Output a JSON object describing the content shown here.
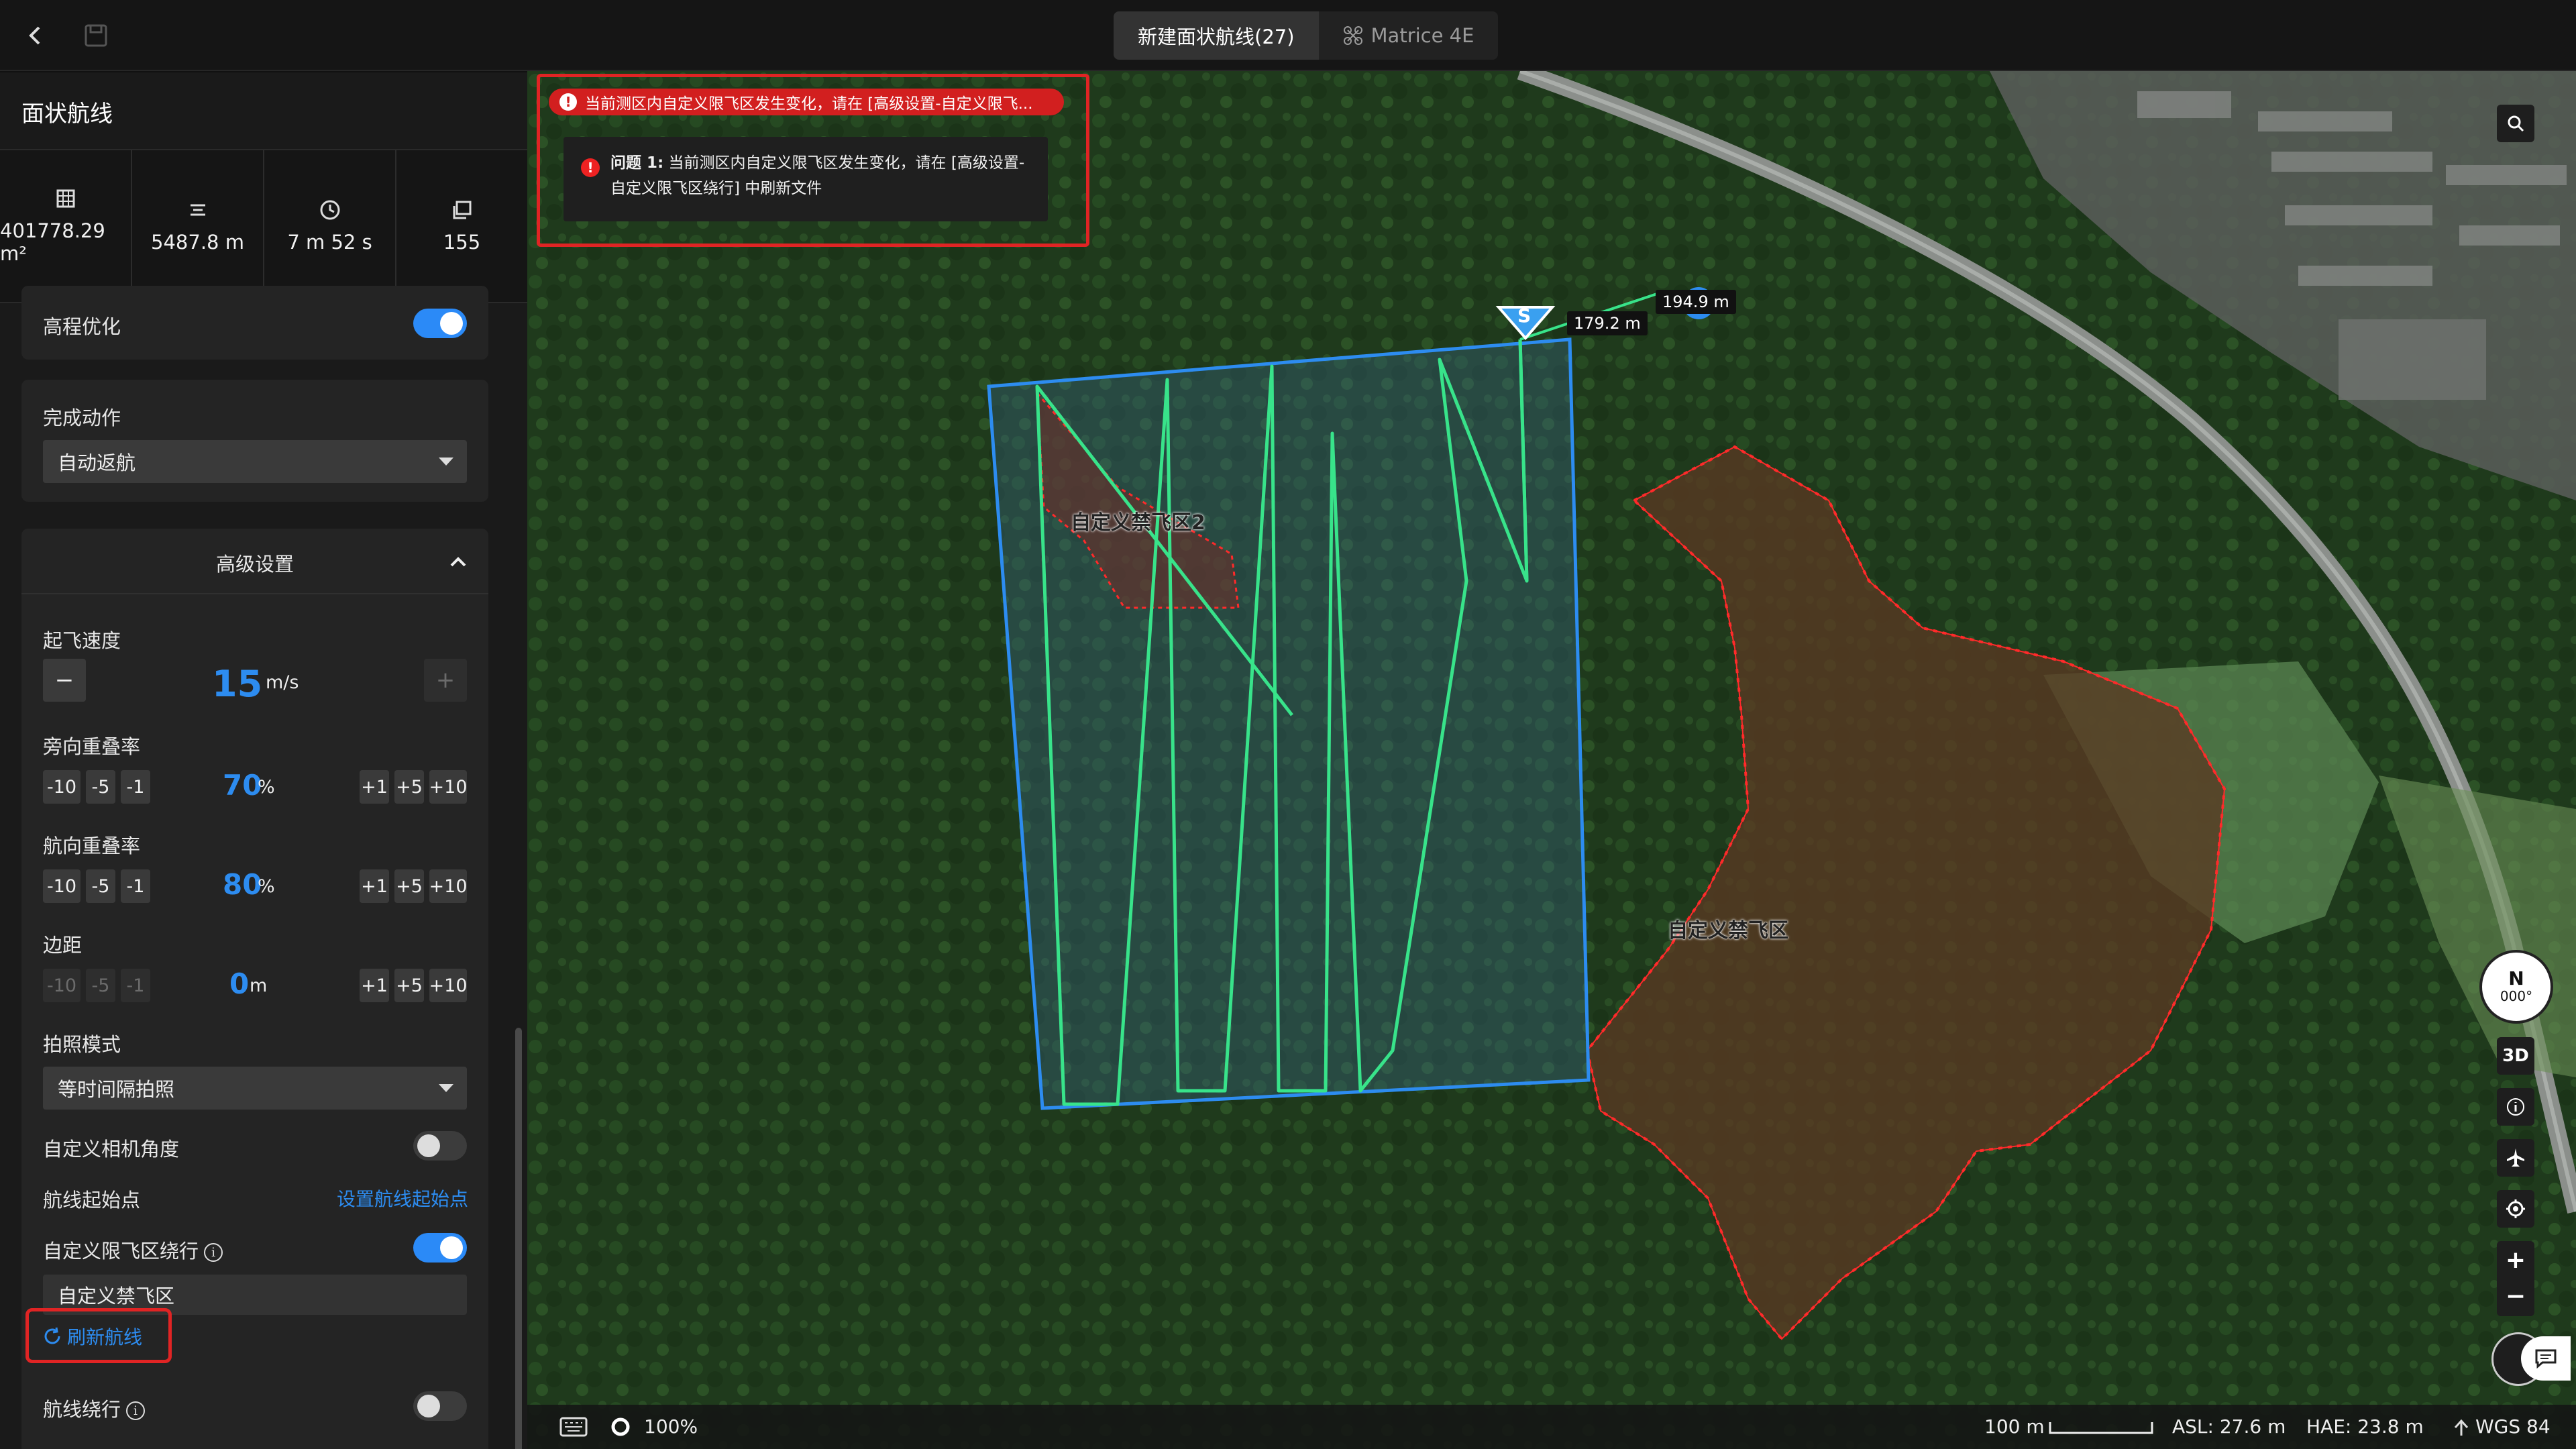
{
  "header": {
    "tabs": [
      {
        "label": "新建面状航线(27)",
        "active": true
      },
      {
        "label": "Matrice 4E",
        "active": false
      }
    ]
  },
  "sidebar": {
    "title": "面状航线",
    "stats": [
      {
        "icon": "area-icon",
        "value": "401778.29 m²"
      },
      {
        "icon": "distance-icon",
        "value": "5487.8 m"
      },
      {
        "icon": "clock-icon",
        "value": "7 m 52 s"
      },
      {
        "icon": "photo-count-icon",
        "value": "155"
      }
    ],
    "elevation_opt": {
      "label": "高程优化",
      "on": true
    },
    "finish_action": {
      "label": "完成动作",
      "value": "自动返航"
    },
    "advanced": {
      "title": "高级设置",
      "takeoff_speed": {
        "label": "起飞速度",
        "value": "15",
        "unit": "m/s",
        "minus": "−",
        "plus": "+"
      },
      "side_overlap": {
        "label": "旁向重叠率",
        "value": "70",
        "unit": "%",
        "buttons": [
          "-10",
          "-5",
          "-1",
          "+1",
          "+5",
          "+10"
        ]
      },
      "front_overlap": {
        "label": "航向重叠率",
        "value": "80",
        "unit": "%",
        "buttons": [
          "-10",
          "-5",
          "-1",
          "+1",
          "+5",
          "+10"
        ]
      },
      "margin": {
        "label": "边距",
        "value": "0",
        "unit": "m",
        "buttons": [
          "-10",
          "-5",
          "-1",
          "+1",
          "+5",
          "+10"
        ]
      },
      "photo_mode": {
        "label": "拍照模式",
        "value": "等时间隔拍照"
      },
      "custom_cam_angle": {
        "label": "自定义相机角度",
        "on": false
      },
      "route_start": {
        "label": "航线起始点",
        "link": "设置航线起始点"
      },
      "nfz_bypass": {
        "label": "自定义限飞区绕行",
        "on": true,
        "zone": "自定义禁飞区",
        "refresh": "刷新航线"
      },
      "route_bypass": {
        "label": "航线绕行",
        "on": false
      }
    }
  },
  "alert": {
    "summary": "当前测区内自定义限飞区发生变化，请在 [高级设置-自定义限飞...",
    "detail_prefix": "问题 1:",
    "detail_line1": "当前测区内自定义限飞区发生变化，请在 [高级设置-",
    "detail_line2": "自定义限飞区绕行] 中刷新文件"
  },
  "map": {
    "labels": {
      "zone1": "自定义禁飞区2",
      "zone2": "自定义禁飞区",
      "start_marker": "S"
    },
    "distances": {
      "d1": "179.2 m",
      "d2": "194.9 m"
    },
    "compass": {
      "dir": "N",
      "deg": "000°"
    },
    "tools": {
      "btn3d": "3D",
      "zoom_in": "+",
      "zoom_out": "−"
    },
    "colors": {
      "route": "#38e38a",
      "area": "#2d8cf0",
      "nfz": "#e02020"
    }
  },
  "statusbar": {
    "zoom": "100%",
    "scale": "100 m",
    "asl": "ASL: 27.6 m",
    "hae": "HAE: 23.8 m",
    "crs": "WGS 84"
  }
}
